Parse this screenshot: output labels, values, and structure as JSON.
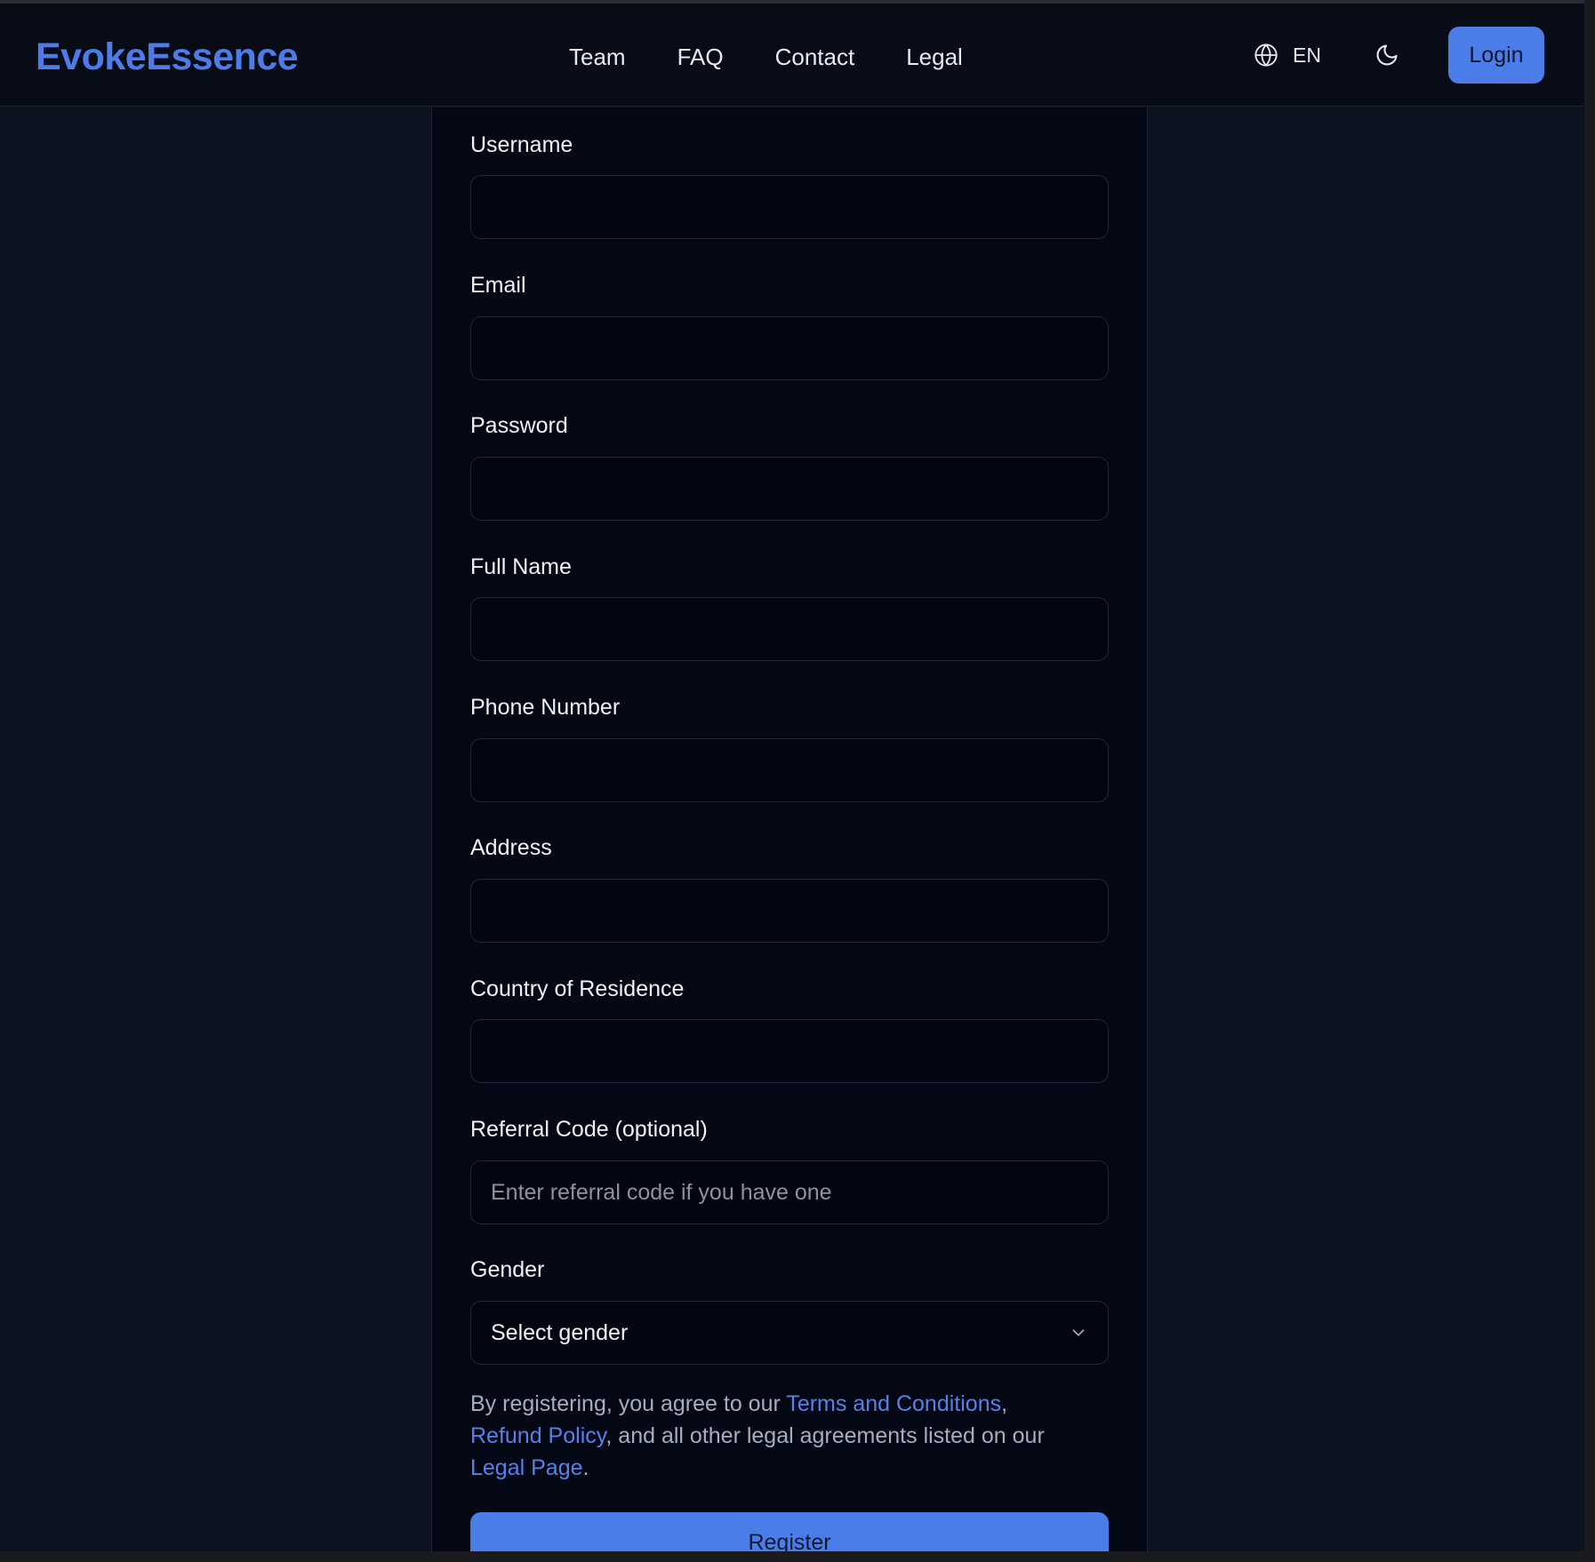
{
  "nav": {
    "brand": "EvokeEssence",
    "links": [
      "Team",
      "FAQ",
      "Contact",
      "Legal"
    ],
    "language": "EN",
    "login_label": "Login",
    "icons": {
      "language": "globe-icon",
      "theme": "moon-icon"
    }
  },
  "form": {
    "username_label": "Username",
    "email_label": "Email",
    "password_label": "Password",
    "full_name_label": "Full Name",
    "phone_label": "Phone Number",
    "address_label": "Address",
    "country_label": "Country of Residence",
    "referral_label": "Referral Code (optional)",
    "referral_placeholder": "Enter referral code if you have one",
    "gender_label": "Gender",
    "gender_value": "Select gender",
    "legal": {
      "prefix": "By registering, you agree to our ",
      "terms_link": "Terms and Conditions",
      "sep": ",",
      "refund_link": "Refund Policy",
      "middle": ", and all other legal agreements listed on our",
      "legal_page_link": "Legal Page",
      "suffix": "."
    },
    "register_label": "Register"
  },
  "colors": {
    "accent": "#4b7de8",
    "link": "#5582ea",
    "background": "#0c1220",
    "card": "#040815"
  }
}
